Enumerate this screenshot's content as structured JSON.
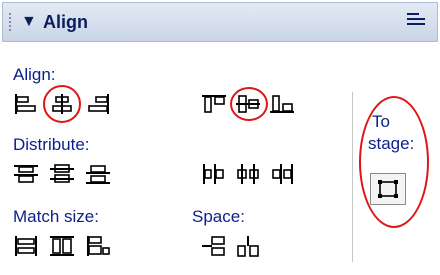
{
  "panel": {
    "title": "Align"
  },
  "sections": {
    "align": "Align:",
    "distribute": "Distribute:",
    "match_size": "Match size:",
    "space": "Space:"
  },
  "to_stage": {
    "line1": "To",
    "line2": "stage:"
  },
  "colors": {
    "label_blue": "#0a1f8c",
    "highlight_red": "#e01616",
    "titlebar": "#d3dcea"
  }
}
